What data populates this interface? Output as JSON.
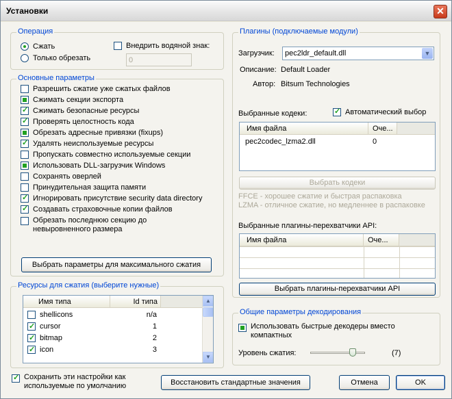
{
  "window": {
    "title": "Установки",
    "close_label": "✕"
  },
  "operation": {
    "legend": "Операция",
    "radio_compress": "Сжать",
    "radio_trim": "Только обрезать",
    "watermark_label": "Внедрить водяной знак:",
    "watermark_value": "0"
  },
  "main_params": {
    "legend": "Основные параметры",
    "items": [
      {
        "label": "Разрешить сжатие уже сжатых файлов",
        "state": "unchecked"
      },
      {
        "label": "Сжимать секции экспорта",
        "state": "mixed"
      },
      {
        "label": "Сжимать безопасные ресурсы",
        "state": "checked"
      },
      {
        "label": "Проверять целостность кода",
        "state": "checked"
      },
      {
        "label": "Обрезать адресные привязки (fixups)",
        "state": "mixed"
      },
      {
        "label": "Удалять неиспользуемые ресурсы",
        "state": "checked"
      },
      {
        "label": "Пропускать совместно используемые секции",
        "state": "unchecked"
      },
      {
        "label": "Использовать DLL-загрузчик Windows",
        "state": "mixed"
      },
      {
        "label": "Сохранять оверлей",
        "state": "unchecked"
      },
      {
        "label": "Принудительная защита памяти",
        "state": "unchecked"
      },
      {
        "label": "Игнорировать присутствие security data directory",
        "state": "checked"
      },
      {
        "label": "Создавать страховочные копии файлов",
        "state": "checked"
      },
      {
        "label": "Обрезать последнюю секцию до невыровненного размера",
        "state": "unchecked"
      }
    ],
    "max_button": "Выбрать параметры для максимального сжатия"
  },
  "resources": {
    "legend": "Ресурсы для сжатия (выберите нужные)",
    "col_type": "Имя типа",
    "col_id": "Id типа",
    "rows": [
      {
        "name": "shellicons",
        "id": "n/a",
        "checked": false
      },
      {
        "name": "cursor",
        "id": "1",
        "checked": true
      },
      {
        "name": "bitmap",
        "id": "2",
        "checked": true
      },
      {
        "name": "icon",
        "id": "3",
        "checked": true
      }
    ]
  },
  "plugins": {
    "legend": "Плагины (подключаемые модули)",
    "loader_label": "Загрузчик:",
    "loader_value": "pec2ldr_default.dll",
    "desc_label": "Описание:",
    "desc_value": "Default Loader",
    "author_label": "Автор:",
    "author_value": "Bitsum Technologies",
    "codecs_label": "Выбранные кодеки:",
    "auto_select_label": "Автоматический выбор",
    "codec_col_file": "Имя файла",
    "codec_col_order": "Оче...",
    "codec_rows": [
      {
        "file": "pec2codec_lzma2.dll",
        "order": "0"
      }
    ],
    "choose_codecs_button": "Выбрать кодеки",
    "hint_ffce": "FFCE - хорошее сжатие и быстрая распаковка",
    "hint_lzma": "LZMA - отличное сжатие, но медленнее в распаковке",
    "api_label": "Выбранные плагины-перехватчики API:",
    "api_col_file": "Имя файла",
    "api_col_order": "Оче...",
    "choose_api_button": "Выбрать плагины-перехватчики API"
  },
  "decoding": {
    "legend": "Общие параметры декодирования",
    "fast_decoders_label": "Использовать быстрые декодеры вместо компактных",
    "level_label": "Уровень сжатия:",
    "level_value": "(7)",
    "level_fraction": 0.78
  },
  "footer": {
    "save_default_label": "Сохранить эти настройки как используемые по умолчанию",
    "restore_button": "Восстановить стандартные значения",
    "cancel_button": "Отмена",
    "ok_button": "OK"
  }
}
